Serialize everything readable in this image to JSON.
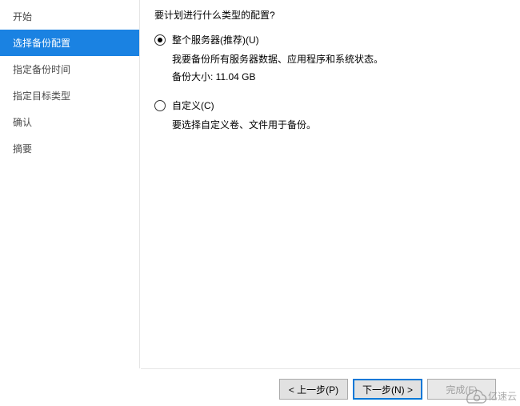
{
  "sidebar": {
    "items": [
      {
        "label": "开始",
        "active": false
      },
      {
        "label": "选择备份配置",
        "active": true
      },
      {
        "label": "指定备份时间",
        "active": false
      },
      {
        "label": "指定目标类型",
        "active": false
      },
      {
        "label": "确认",
        "active": false
      },
      {
        "label": "摘要",
        "active": false
      }
    ]
  },
  "main": {
    "question": "要计划进行什么类型的配置?",
    "options": [
      {
        "value": "full",
        "label": "整个服务器(推荐)(U)",
        "desc_line1": "我要备份所有服务器数据、应用程序和系统状态。",
        "desc_line2": "备份大小: 11.04 GB",
        "checked": true
      },
      {
        "value": "custom",
        "label": "自定义(C)",
        "desc_line1": "要选择自定义卷、文件用于备份。",
        "desc_line2": "",
        "checked": false
      }
    ]
  },
  "buttons": {
    "prev": "< 上一步(P)",
    "next": "下一步(N) >",
    "finish": "完成(F)"
  },
  "watermark": "亿速云"
}
